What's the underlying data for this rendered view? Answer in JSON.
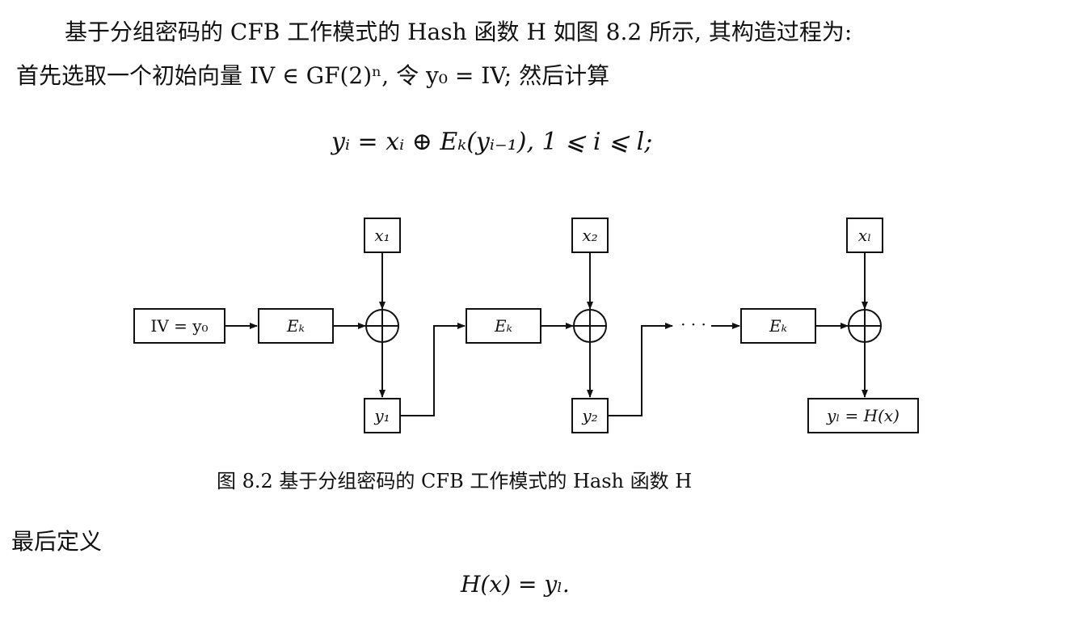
{
  "text": {
    "para1": "基于分组密码的 CFB 工作模式的 Hash 函数 H 如图 8.2 所示, 其构造过程为:",
    "para2": "首先选取一个初始向量 IV ∈ GF(2)ⁿ, 令 y₀ = IV; 然后计算",
    "equation1": "yᵢ = xᵢ ⊕ Eₖ(yᵢ₋₁),    1 ⩽ i ⩽ l;",
    "caption": "图 8.2   基于分组密码的 CFB 工作模式的 Hash 函数 H",
    "para3": "最后定义",
    "equation2": "H(x) = yₗ."
  },
  "diagram": {
    "iv_box": "IV = y₀",
    "encrypt_label": "Eₖ",
    "inputs": [
      "x₁",
      "x₂",
      "xₗ"
    ],
    "outputs": [
      "y₁",
      "y₂",
      "yₗ = H(x)"
    ],
    "ellipsis": "· · ·",
    "xor_symbol": "⊕"
  }
}
